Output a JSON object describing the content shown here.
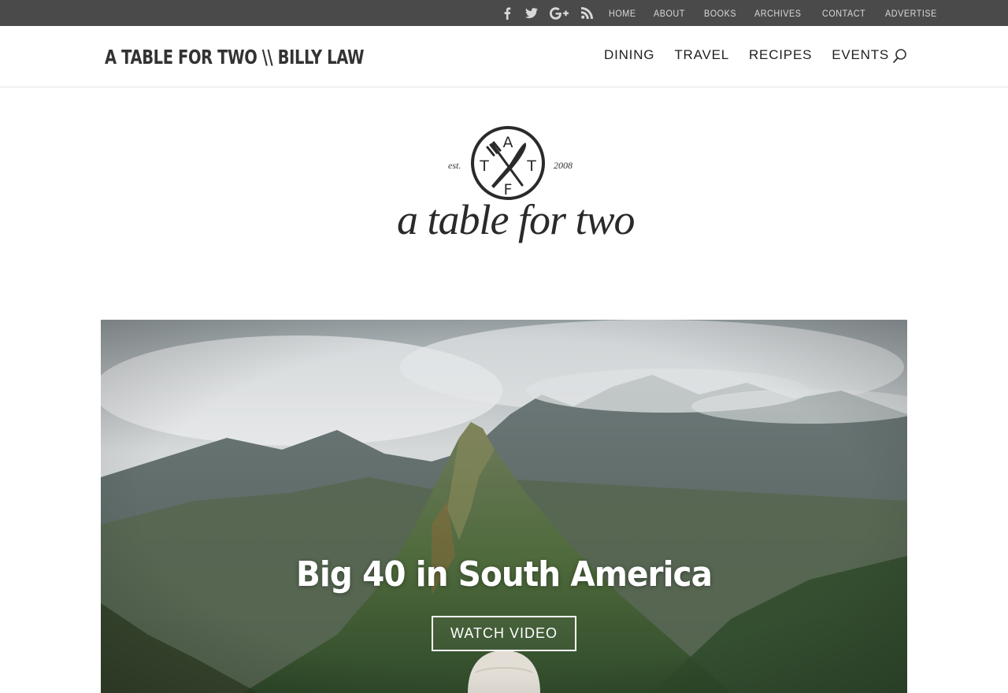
{
  "topbar": {
    "social": [
      "facebook-icon",
      "twitter-icon",
      "google-plus-icon",
      "rss-icon"
    ],
    "links": [
      "HOME",
      "ABOUT",
      "BOOKS",
      "ARCHIVES",
      "CONTACT",
      "ADVERTISE"
    ]
  },
  "header": {
    "site_title": "A TABLE FOR TWO \\\\ BILLY LAW",
    "nav": [
      "DINING",
      "TRAVEL",
      "RECIPES",
      "EVENTS"
    ],
    "search_icon": "search-icon"
  },
  "logo": {
    "est": "est.",
    "year": "2008",
    "letters": [
      "A",
      "T",
      "T",
      "F"
    ],
    "wordmark": "a table for two"
  },
  "hero": {
    "title": "Big 40 in South America",
    "button": "WATCH VIDEO"
  },
  "colors": {
    "topbar_bg": "#4a4a4a",
    "topbar_text": "#d9d9d9",
    "nav_text": "#222222",
    "hero_text": "#ffffff"
  }
}
